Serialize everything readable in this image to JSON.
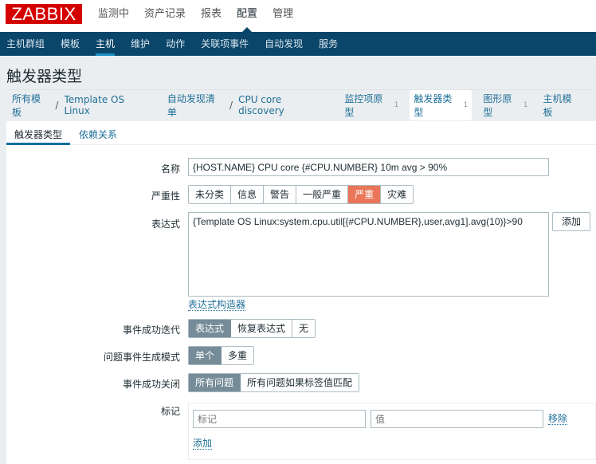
{
  "app": {
    "logo": "ZABBIX"
  },
  "top_menu": [
    {
      "label": "监测中",
      "active": false
    },
    {
      "label": "资产记录",
      "active": false
    },
    {
      "label": "报表",
      "active": false
    },
    {
      "label": "配置",
      "active": true
    },
    {
      "label": "管理",
      "active": false
    }
  ],
  "sub_menu": [
    {
      "label": "主机群组",
      "active": false
    },
    {
      "label": "模板",
      "active": false
    },
    {
      "label": "主机",
      "active": true
    },
    {
      "label": "维护",
      "active": false
    },
    {
      "label": "动作",
      "active": false
    },
    {
      "label": "关联项事件",
      "active": false
    },
    {
      "label": "自动发现",
      "active": false
    },
    {
      "label": "服务",
      "active": false
    }
  ],
  "page": {
    "title": "触发器类型"
  },
  "breadcrumb": {
    "all_templates": "所有模板",
    "template": "Template OS Linux",
    "discovery_list": "自动发现清单",
    "discovery_rule": "CPU core discovery",
    "separator": "/",
    "tabs": [
      {
        "label": "监控项原型",
        "count": "1"
      },
      {
        "label": "触发器类型",
        "count": "1",
        "active": true
      },
      {
        "label": "图形原型",
        "count": "1"
      },
      {
        "label": "主机模板",
        "count": ""
      }
    ]
  },
  "form_tabs": [
    {
      "label": "触发器类型",
      "active": true
    },
    {
      "label": "依赖关系",
      "active": false
    }
  ],
  "form": {
    "name": {
      "label": "名称",
      "value": "{HOST.NAME} CPU core {#CPU.NUMBER} 10m avg > 90%"
    },
    "severity": {
      "label": "严重性",
      "options": [
        "未分类",
        "信息",
        "警告",
        "一般严重",
        "严重",
        "灾难"
      ],
      "selected": "严重",
      "selected_color": "#e97659"
    },
    "expression": {
      "label": "表达式",
      "value": "{Template OS Linux:system.cpu.util[{#CPU.NUMBER},user,avg1].avg(10)}>90",
      "add_button": "添加",
      "builder_link": "表达式构造器"
    },
    "ok_event_generation": {
      "label": "事件成功迭代",
      "options": [
        "表达式",
        "恢复表达式",
        "无"
      ],
      "selected": "表达式"
    },
    "problem_event_mode": {
      "label": "问题事件生成模式",
      "options": [
        "单个",
        "多重"
      ],
      "selected": "单个"
    },
    "ok_event_closes": {
      "label": "事件成功关闭",
      "options": [
        "所有问题",
        "所有问题如果标签值匹配"
      ],
      "selected": "所有问题"
    },
    "tags": {
      "label": "标记",
      "rows": [
        {
          "tag_placeholder": "标记",
          "value_placeholder": "值",
          "tag_value": "",
          "value_value": "",
          "remove_label": "移除"
        }
      ],
      "add_label": "添加"
    }
  },
  "colors": {
    "nav_bg": "#0a466a",
    "logo_bg": "#d40000",
    "link": "#1f6f99",
    "selected_seg": "#768d99"
  }
}
